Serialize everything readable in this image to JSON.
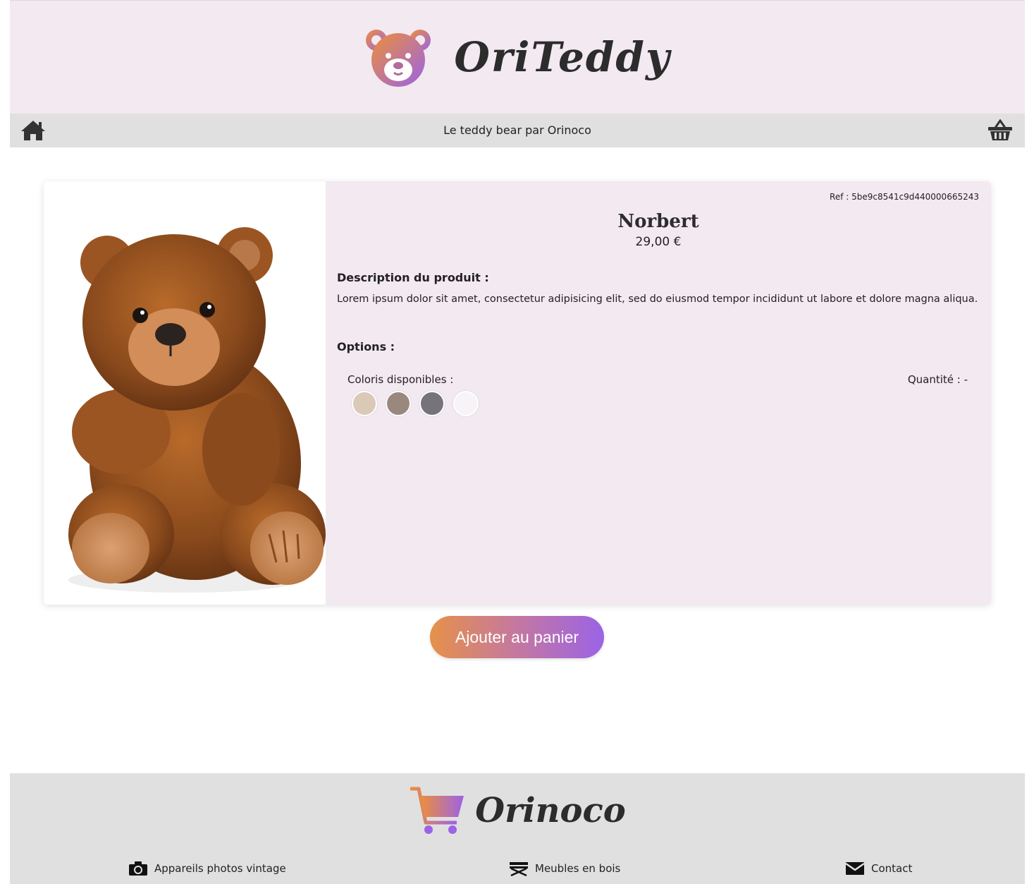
{
  "header": {
    "brand_name": "OriTeddy"
  },
  "nav": {
    "tagline": "Le teddy bear par Orinoco",
    "home_icon": "home-icon",
    "basket_icon": "basket-icon"
  },
  "product": {
    "ref": "Ref : 5be9c8541c9d440000665243",
    "name": "Norbert",
    "price": "29,00 €",
    "description_heading": "Description du produit :",
    "description": "Lorem ipsum dolor sit amet, consectetur adipisicing elit, sed do eiusmod tempor incididunt ut labore et dolore magna aliqua.",
    "options_heading": "Options :",
    "colors_label": "Coloris disponibles :",
    "colors": [
      "#dbc9b7",
      "#9a887f",
      "#76747a",
      "#f7f3f7"
    ],
    "quantity_label": "Quantité : -"
  },
  "actions": {
    "add_to_cart": "Ajouter au panier"
  },
  "footer": {
    "brand_name": "Orinoco",
    "links": [
      {
        "label": "Appareils photos vintage",
        "icon": "camera-icon"
      },
      {
        "label": "Meubles en bois",
        "icon": "furniture-icon"
      },
      {
        "label": "Contact",
        "icon": "envelope-icon"
      }
    ]
  },
  "colors": {
    "header_bg": "#f3e9f1",
    "nav_bg": "#e0e0e0",
    "gradient_start": "#e6914a",
    "gradient_end": "#9b63e6"
  }
}
